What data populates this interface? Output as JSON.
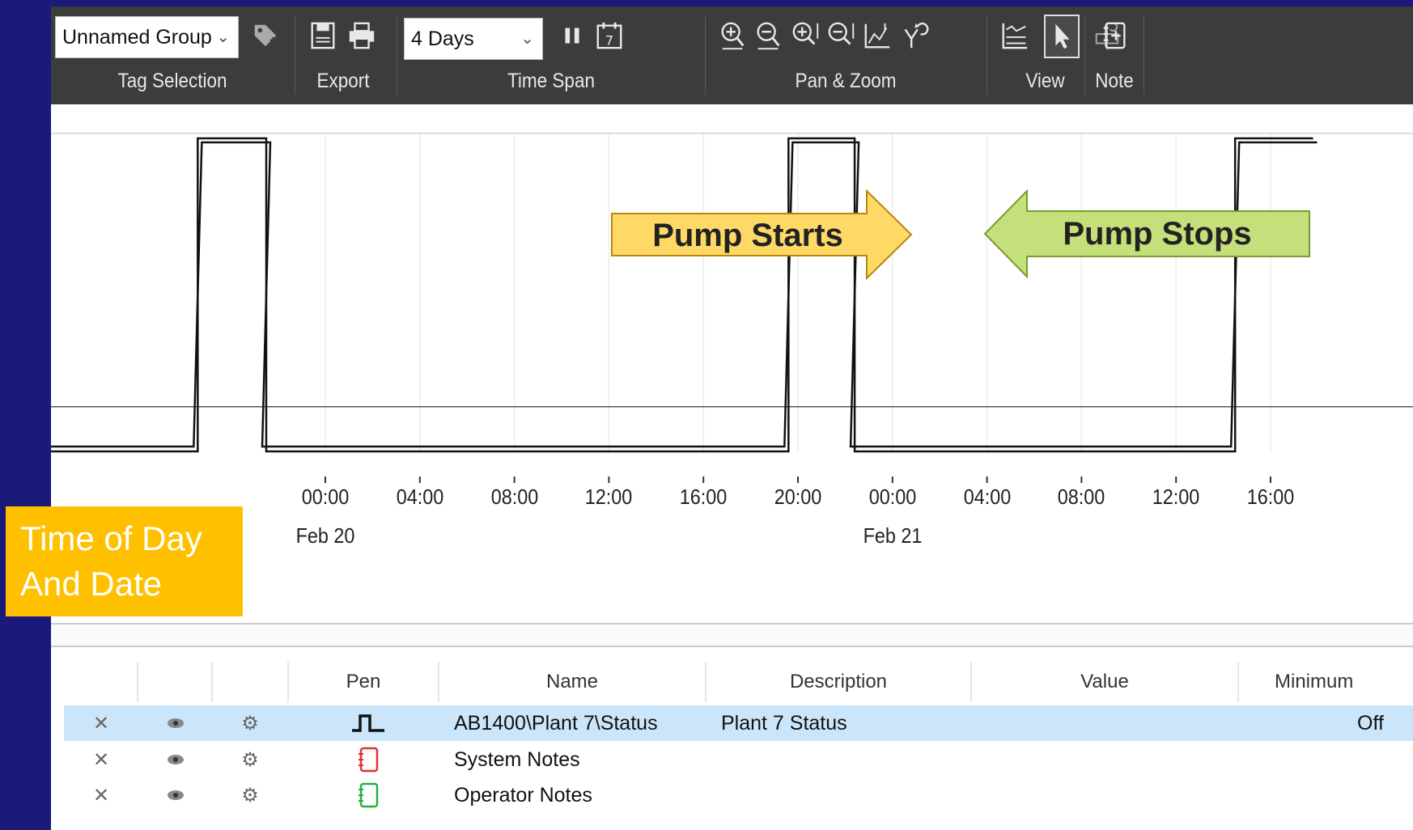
{
  "toolbar": {
    "tag_selection": {
      "dropdown_value": "Unnamed Group",
      "label": "Tag Selection"
    },
    "export": {
      "label": "Export"
    },
    "time_span": {
      "dropdown_value": "4 Days",
      "label": "Time Span"
    },
    "pan_zoom": {
      "label": "Pan & Zoom"
    },
    "view": {
      "label": "View"
    },
    "note": {
      "label": "Note"
    }
  },
  "axis": {
    "times": [
      "00:00",
      "04:00",
      "08:00",
      "12:00",
      "16:00",
      "20:00",
      "00:00",
      "04:00",
      "08:00",
      "12:00",
      "16:00"
    ],
    "dates": [
      {
        "text": "Feb 20",
        "at_index": 0
      },
      {
        "text": "Feb 21",
        "at_index": 6
      }
    ]
  },
  "chart_data": {
    "type": "line",
    "step": true,
    "series": [
      {
        "values": [
          [
            -5.4,
            0
          ],
          [
            -5.4,
            1
          ],
          [
            -2.5,
            1
          ],
          [
            -2.5,
            0
          ],
          [
            19.6,
            0
          ],
          [
            19.6,
            1
          ],
          [
            22.4,
            1
          ],
          [
            22.4,
            0
          ],
          [
            38.5,
            0
          ],
          [
            38.5,
            1
          ],
          [
            41.8,
            1
          ]
        ]
      }
    ],
    "ylim": [
      0,
      1
    ],
    "tick_hours": [
      0,
      4,
      8,
      12,
      16,
      20,
      24,
      28,
      32,
      36,
      40
    ]
  },
  "callouts": {
    "pump_starts": "Pump Starts",
    "pump_stops": "Pump Stops",
    "time_of_day": [
      "Time of Day",
      "And Date"
    ]
  },
  "table": {
    "headers": [
      "Pen",
      "Name",
      "Description",
      "Value",
      "Minimum"
    ],
    "rows": [
      {
        "pen": "step-pen-icon",
        "name": "AB1400\\Plant 7\\Status",
        "description": "Plant 7 Status",
        "value": "",
        "minimum": "Off",
        "selected": true
      },
      {
        "pen": "red-notebook-icon",
        "name": "System Notes",
        "description": "",
        "value": "",
        "minimum": "",
        "selected": false
      },
      {
        "pen": "green-notebook-icon",
        "name": "Operator Notes",
        "description": "",
        "value": "",
        "minimum": "",
        "selected": false
      }
    ]
  },
  "colors": {
    "background": "#1a1a7a",
    "toolbar": "#3c3c3c",
    "callout_start": "#ffd966",
    "callout_stop": "#c5e07a",
    "time_callout": "#ffc000",
    "selected_row": "#cbe6fb"
  }
}
